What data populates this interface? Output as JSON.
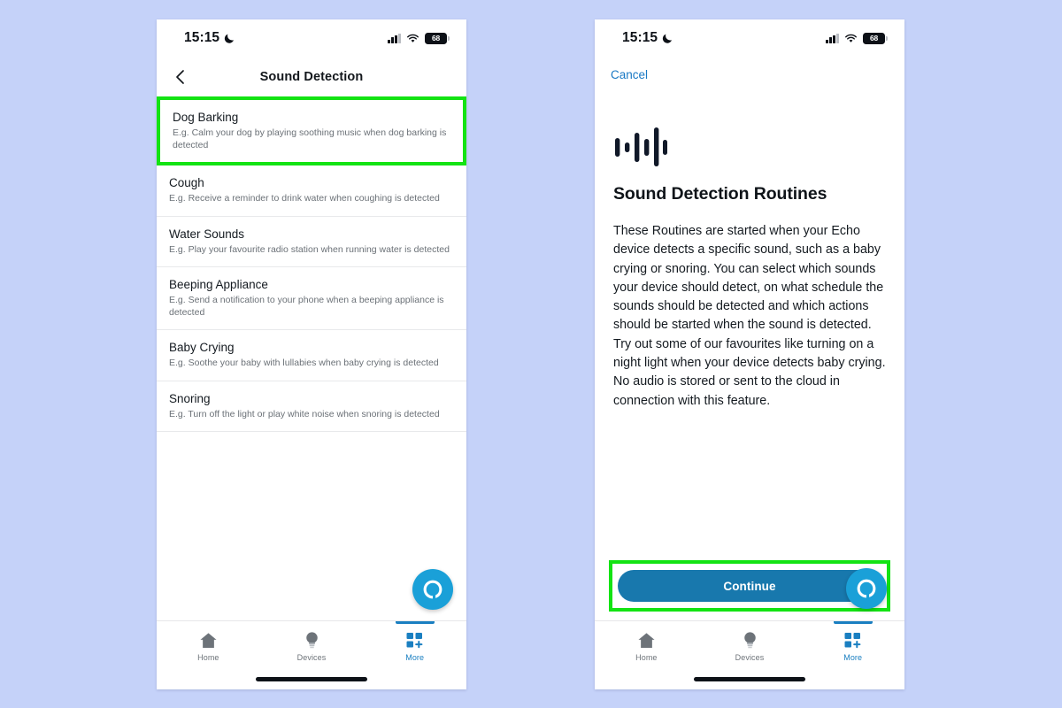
{
  "background_color": "#c5d2f9",
  "highlight_color": "#13e313",
  "accent_color": "#1878c4",
  "alexa_blue": "#1aa0d8",
  "status_bar": {
    "time": "15:15",
    "moon_icon": "crescent-moon-icon",
    "cellular_icon": "cellular-signal-icon",
    "wifi_icon": "wifi-icon",
    "battery_level": "68"
  },
  "left_screen": {
    "nav": {
      "back_icon": "chevron-left-icon",
      "title": "Sound Detection"
    },
    "sounds": [
      {
        "title": "Dog Barking",
        "description": "E.g. Calm your dog by playing soothing music when dog barking is detected",
        "highlighted": true
      },
      {
        "title": "Cough",
        "description": "E.g. Receive a reminder to drink water when coughing is detected",
        "highlighted": false
      },
      {
        "title": "Water Sounds",
        "description": "E.g. Play your favourite radio station when running water is detected",
        "highlighted": false
      },
      {
        "title": "Beeping Appliance",
        "description": "E.g. Send a notification to your phone when a beeping appliance is detected",
        "highlighted": false
      },
      {
        "title": "Baby Crying",
        "description": "E.g. Soothe your baby with lullabies when baby crying is detected",
        "highlighted": false
      },
      {
        "title": "Snoring",
        "description": "E.g. Turn off the light or play white noise when snoring is detected",
        "highlighted": false
      }
    ],
    "fab": {
      "icon": "alexa-logo-icon"
    },
    "tabs": [
      {
        "label": "Home",
        "icon": "home-icon",
        "active": false
      },
      {
        "label": "Devices",
        "icon": "lightbulb-icon",
        "active": false
      },
      {
        "label": "More",
        "icon": "more-grid-plus-icon",
        "active": true
      }
    ]
  },
  "right_screen": {
    "cancel_label": "Cancel",
    "hero_icon": "sound-waveform-icon",
    "title": "Sound Detection Routines",
    "paragraph": "These Routines are started when your Echo device detects a specific sound, such as a baby crying or snoring. You can select which sounds your device should detect, on what schedule the sounds should be detected and which actions should be started when the sound is detected. Try out some of our favourites like turning on a night light when your device detects baby crying. No audio is stored or sent to the cloud in connection with this feature.",
    "continue_label": "Continue",
    "continue_highlighted": true,
    "fab": {
      "icon": "alexa-logo-icon"
    },
    "tabs": [
      {
        "label": "Home",
        "icon": "home-icon",
        "active": false
      },
      {
        "label": "Devices",
        "icon": "lightbulb-icon",
        "active": false
      },
      {
        "label": "More",
        "icon": "more-grid-plus-icon",
        "active": true
      }
    ]
  }
}
